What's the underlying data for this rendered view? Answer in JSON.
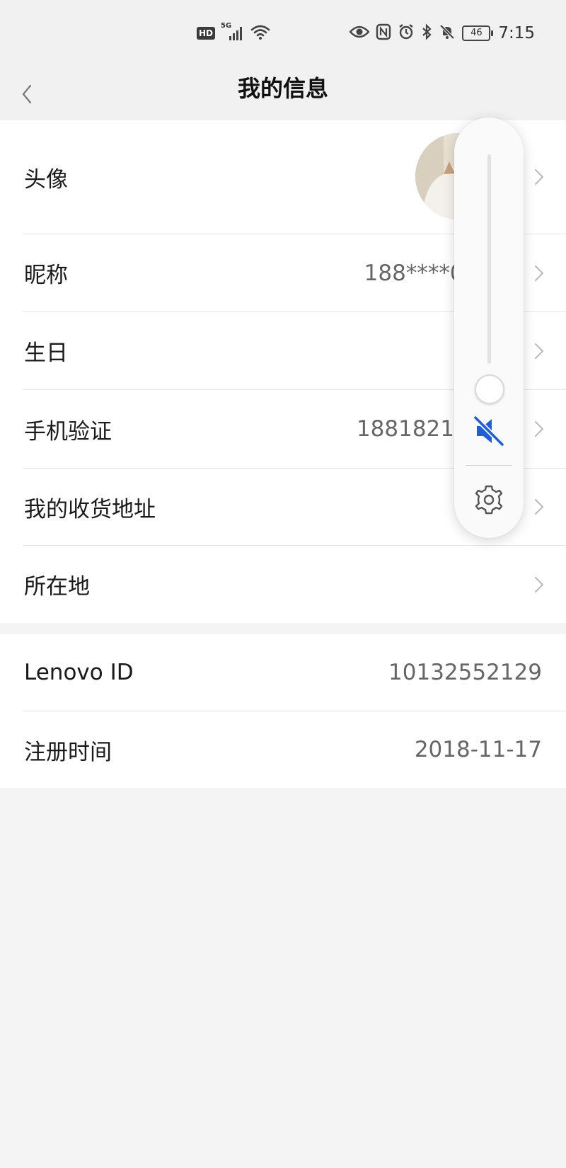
{
  "status_bar": {
    "hd": "HD",
    "network": "5G",
    "battery": "46",
    "time": "7:15"
  },
  "nav": {
    "title": "我的信息"
  },
  "profile": {
    "avatar_label": "头像",
    "nickname_label": "昵称",
    "nickname_value": "188****086",
    "birthday_label": "生日",
    "phone_label": "手机验证",
    "phone_value": "1881821",
    "address_label": "我的收货地址",
    "location_label": "所在地"
  },
  "account": {
    "lenovo_id_label": "Lenovo ID",
    "lenovo_id_value": "10132552129",
    "register_label": "注册时间",
    "register_value": "2018-11-17"
  },
  "volume_panel": {
    "level_fraction": 0.0,
    "muted": true,
    "mute_color": "#1f5fd6"
  },
  "colors": {
    "background": "#f4f4f4",
    "card": "#ffffff",
    "accent_blue": "#1f5fd6"
  },
  "icons": [
    "back-arrow-icon",
    "chevron-right-icon",
    "mute-icon",
    "gear-icon",
    "wifi-icon",
    "signal-icon",
    "eye-icon",
    "nfc-icon",
    "alarm-icon",
    "bluetooth-icon",
    "bell-off-icon"
  ]
}
